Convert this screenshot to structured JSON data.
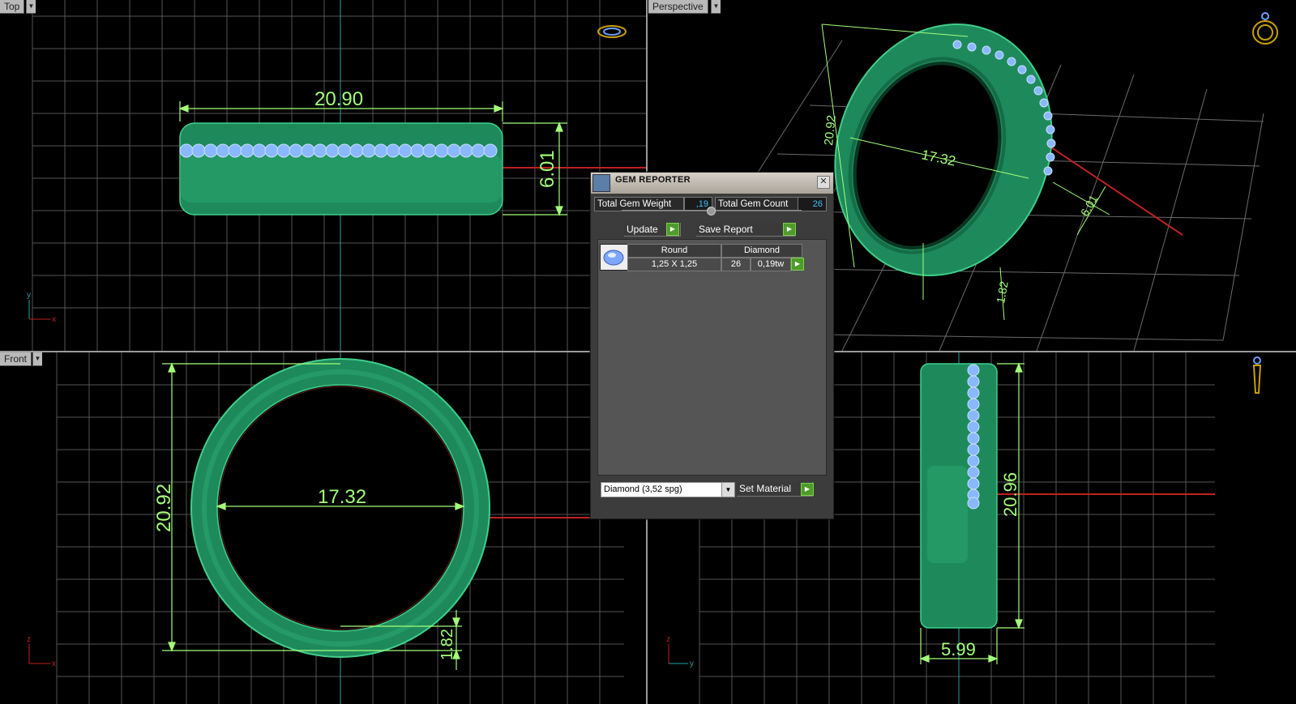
{
  "viewports": {
    "top": {
      "label": "Top",
      "dim_width": "20.90",
      "dim_height": "6.01",
      "axis_a": "y",
      "axis_b": "x"
    },
    "perspective": {
      "label": "Perspective",
      "dim_diameter": "17.32",
      "dim_outer": "20.92",
      "dim_width": "6.01",
      "dim_thickness": "1.82"
    },
    "front": {
      "label": "Front",
      "dim_outer": "20.92",
      "dim_inner": "17.32",
      "dim_thickness": "1.82",
      "axis_a": "z",
      "axis_b": "x"
    },
    "side": {
      "dim_height": "20.96",
      "dim_width": "5.99",
      "axis_a": "z",
      "axis_b": "y"
    }
  },
  "gem_reporter": {
    "title": "GEM REPORTER",
    "total_weight_label": "Total Gem Weight",
    "total_weight_value": ",19",
    "total_count_label": "Total Gem Count",
    "total_count_value": "26",
    "update_label": "Update",
    "save_report_label": "Save Report",
    "table": {
      "headers": [
        "Round",
        "Diamond"
      ],
      "rows": [
        {
          "size": "1,25 X 1,25",
          "count": "26",
          "weight": "0,19tw"
        }
      ]
    },
    "material_select": "Diamond    (3,52 spg)",
    "set_material_label": "Set Material"
  },
  "colors": {
    "ring": "#1e8a5c",
    "gem": "#8ab8ff",
    "dimension": "#a4ff7a",
    "grid": "#6a6a6a",
    "accent_go": "#4e9c2a"
  }
}
